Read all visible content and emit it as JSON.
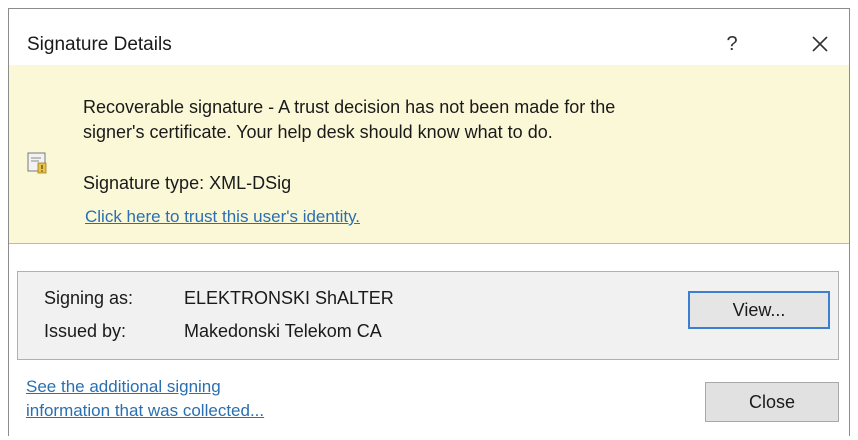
{
  "dialog": {
    "title": "Signature Details",
    "help_label": "?",
    "close_icon": "close-icon"
  },
  "banner": {
    "background": "#fbf8d8",
    "message_line1": "Recoverable signature - A trust decision has not been made for the",
    "message_line2": "signer's certificate.  Your help desk should know what to do.",
    "signature_type": "Signature type: XML-DSig",
    "trust_link": "Click here to trust this user's identity.",
    "icon": "certificate-warning-icon"
  },
  "signer": {
    "signing_as_label": "Signing as:",
    "signing_as_value": "ELEKTRONSKI ShALTER",
    "issued_by_label": "Issued by:",
    "issued_by_value": "Makedonski Telekom CA",
    "view_button": "View..."
  },
  "footer": {
    "additional_link_line1": "See the additional signing",
    "additional_link_line2": "information that was collected...",
    "close_button": "Close"
  },
  "colors": {
    "link": "#2a6fb0",
    "focus_border": "#3c7fd1"
  }
}
